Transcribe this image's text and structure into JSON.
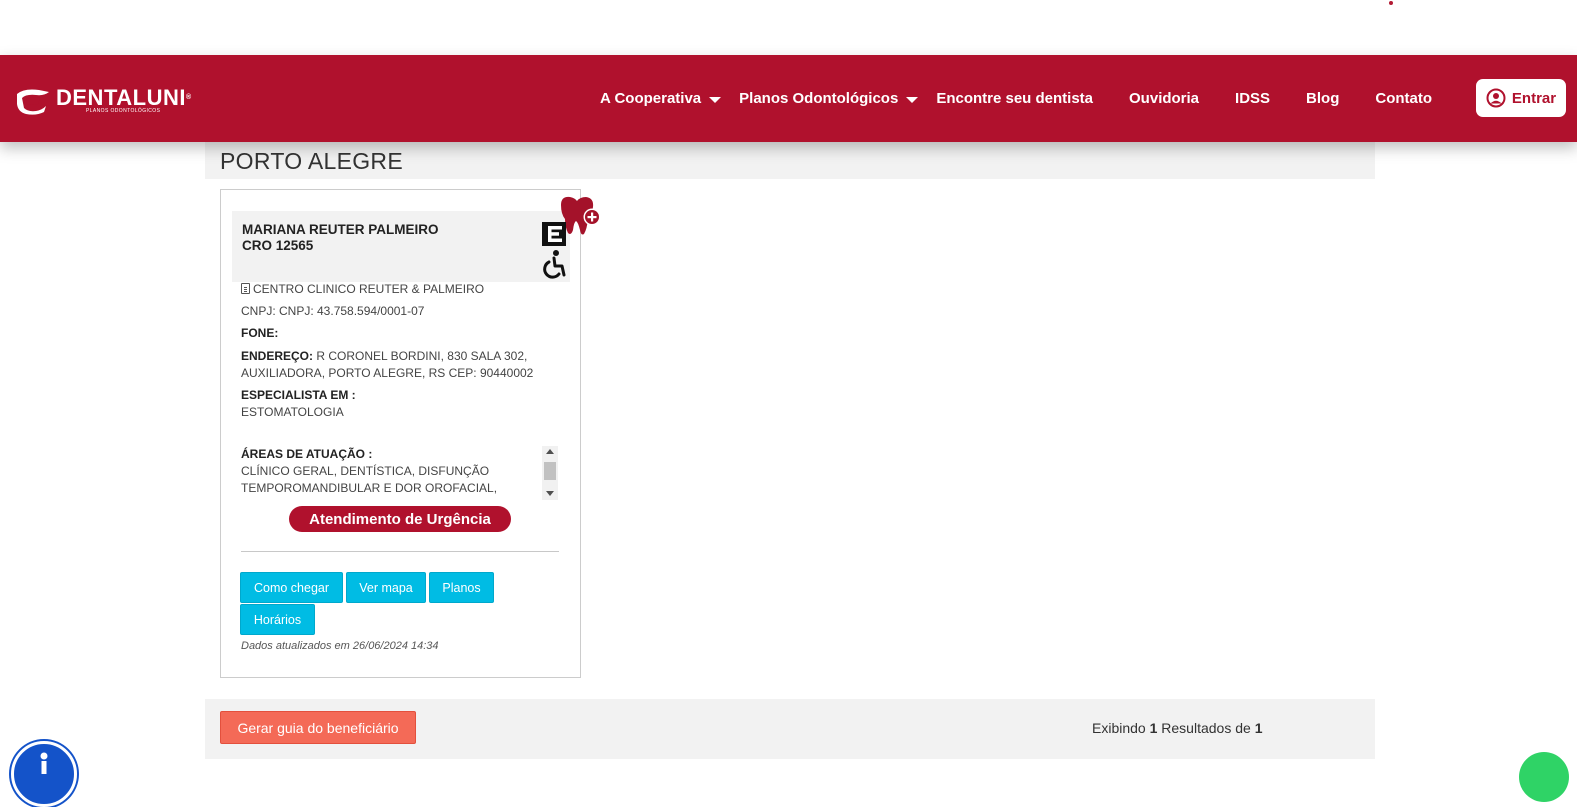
{
  "header": {
    "logo_word": "DENTALUNI",
    "logo_reg": "®",
    "logo_sub": "PLANOS ODONTOLÓGICOS",
    "nav": [
      {
        "label": "A Cooperativa",
        "has_dropdown": true
      },
      {
        "label": "Planos Odontológicos",
        "has_dropdown": true
      },
      {
        "label": "Encontre seu dentista",
        "has_dropdown": false
      },
      {
        "label": "Ouvidoria",
        "has_dropdown": false
      },
      {
        "label": "IDSS",
        "has_dropdown": false
      },
      {
        "label": "Blog",
        "has_dropdown": false
      },
      {
        "label": "Contato",
        "has_dropdown": false
      }
    ],
    "login_label": "Entrar",
    "login_icon": "user-circle-icon"
  },
  "city": "PORTO ALEGRE",
  "card": {
    "name": "MARIANA REUTER PALMEIRO",
    "cro": "CRO 12565",
    "badges": [
      "tooth-plus-icon",
      "e-icon",
      "wheelchair-icon"
    ],
    "clinic": "CENTRO CLINICO REUTER & PALMEIRO",
    "cnpj": "CNPJ: CNPJ: 43.758.594/0001-07",
    "fone_label": "FONE:",
    "fone_value": "",
    "endereco_label": "ENDEREÇO:",
    "endereco_line1": "R CORONEL BORDINI, 830 SALA 302,",
    "endereco_line2": "AUXILIADORA, PORTO ALEGRE, RS CEP: 90440002",
    "especialista_label": "ESPECIALISTA EM :",
    "especialista_value": "ESTOMATOLOGIA",
    "areas_label": "ÁREAS DE ATUAÇÃO :",
    "areas_line1": "CLÍNICO GERAL, DENTÍSTICA, DISFUNÇÃO",
    "areas_line2": "TEMPOROMANDIBULAR E DOR OROFACIAL,",
    "urgencia": "Atendimento de Urgência",
    "buttons": {
      "como_chegar": "Como chegar",
      "ver_mapa": "Ver mapa",
      "planos": "Planos",
      "horarios": "Horários"
    },
    "updated": "Dados atualizados em 26/06/2024 14:34"
  },
  "footer": {
    "guia_label": "Gerar guia do beneficiário",
    "results_prefix": "Exibindo",
    "results_shown": "1",
    "results_middle": "Resultados de",
    "results_total": "1"
  },
  "colors": {
    "brand": "#b0112d",
    "cyan_button": "#00bce4",
    "guia_button": "#f46a57",
    "accessibility": "#1453c9",
    "whatsapp": "#2fd366"
  },
  "floating": [
    "accessibility-icon",
    "whatsapp-icon"
  ]
}
